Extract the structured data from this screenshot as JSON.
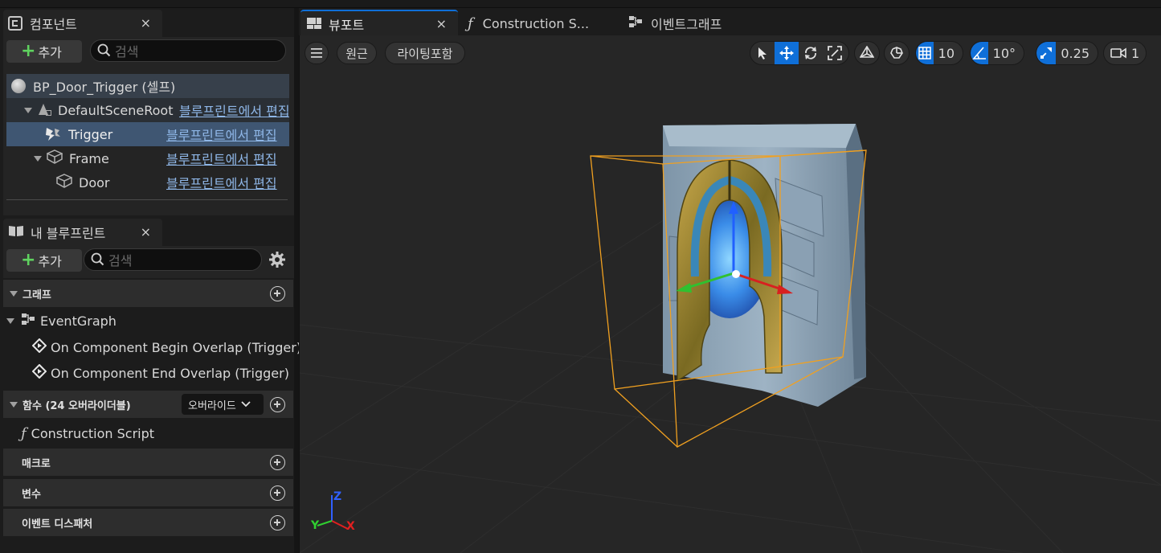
{
  "components_panel": {
    "tab_label": "컴포넌트",
    "close": "×",
    "add_label": "추가",
    "search_placeholder": "검색",
    "root": "BP_Door_Trigger (셀프)",
    "items": [
      {
        "name": "DefaultSceneRoot",
        "link": "블루프린트에서 편집"
      },
      {
        "name": "Trigger",
        "link": "블루프린트에서 편집"
      },
      {
        "name": "Frame",
        "link": "블루프린트에서 편집"
      },
      {
        "name": "Door",
        "link": "블루프린트에서 편집"
      }
    ]
  },
  "my_blueprint": {
    "tab_label": "내 블루프린트",
    "close": "×",
    "add_label": "추가",
    "search_placeholder": "검색",
    "sections": {
      "graphs": "그래프",
      "functions": "함수 (24 오버라이더블)",
      "override_label": "오버라이드",
      "macros": "매크로",
      "variables": "변수",
      "dispatchers": "이벤트 디스패처"
    },
    "event_graph": "EventGraph",
    "events": [
      "On Component Begin Overlap (Trigger)",
      "On Component End Overlap (Trigger)"
    ],
    "construction_script": "Construction Script"
  },
  "editor_tabs": [
    {
      "label": "뷰포트",
      "icon": "viewport-icon",
      "close": "×"
    },
    {
      "label": "Construction S...",
      "icon": "function-icon"
    },
    {
      "label": "이벤트그래프",
      "icon": "graph-icon"
    }
  ],
  "viewport_toolbar": {
    "perspective": "원근",
    "lighting": "라이팅포함",
    "grid_snap": "10",
    "rotation_snap": "10°",
    "scale_snap": "0.25",
    "camera_speed": "1"
  },
  "axis": {
    "x": "X",
    "y": "Y",
    "z": "Z"
  },
  "colors": {
    "accent": "#0f6fd8",
    "selection": "#3f5672",
    "bounds": "#f0a020",
    "link": "#8fb7e8",
    "axis_x": "#e02020",
    "axis_y": "#30d030",
    "axis_z": "#3060ff"
  }
}
